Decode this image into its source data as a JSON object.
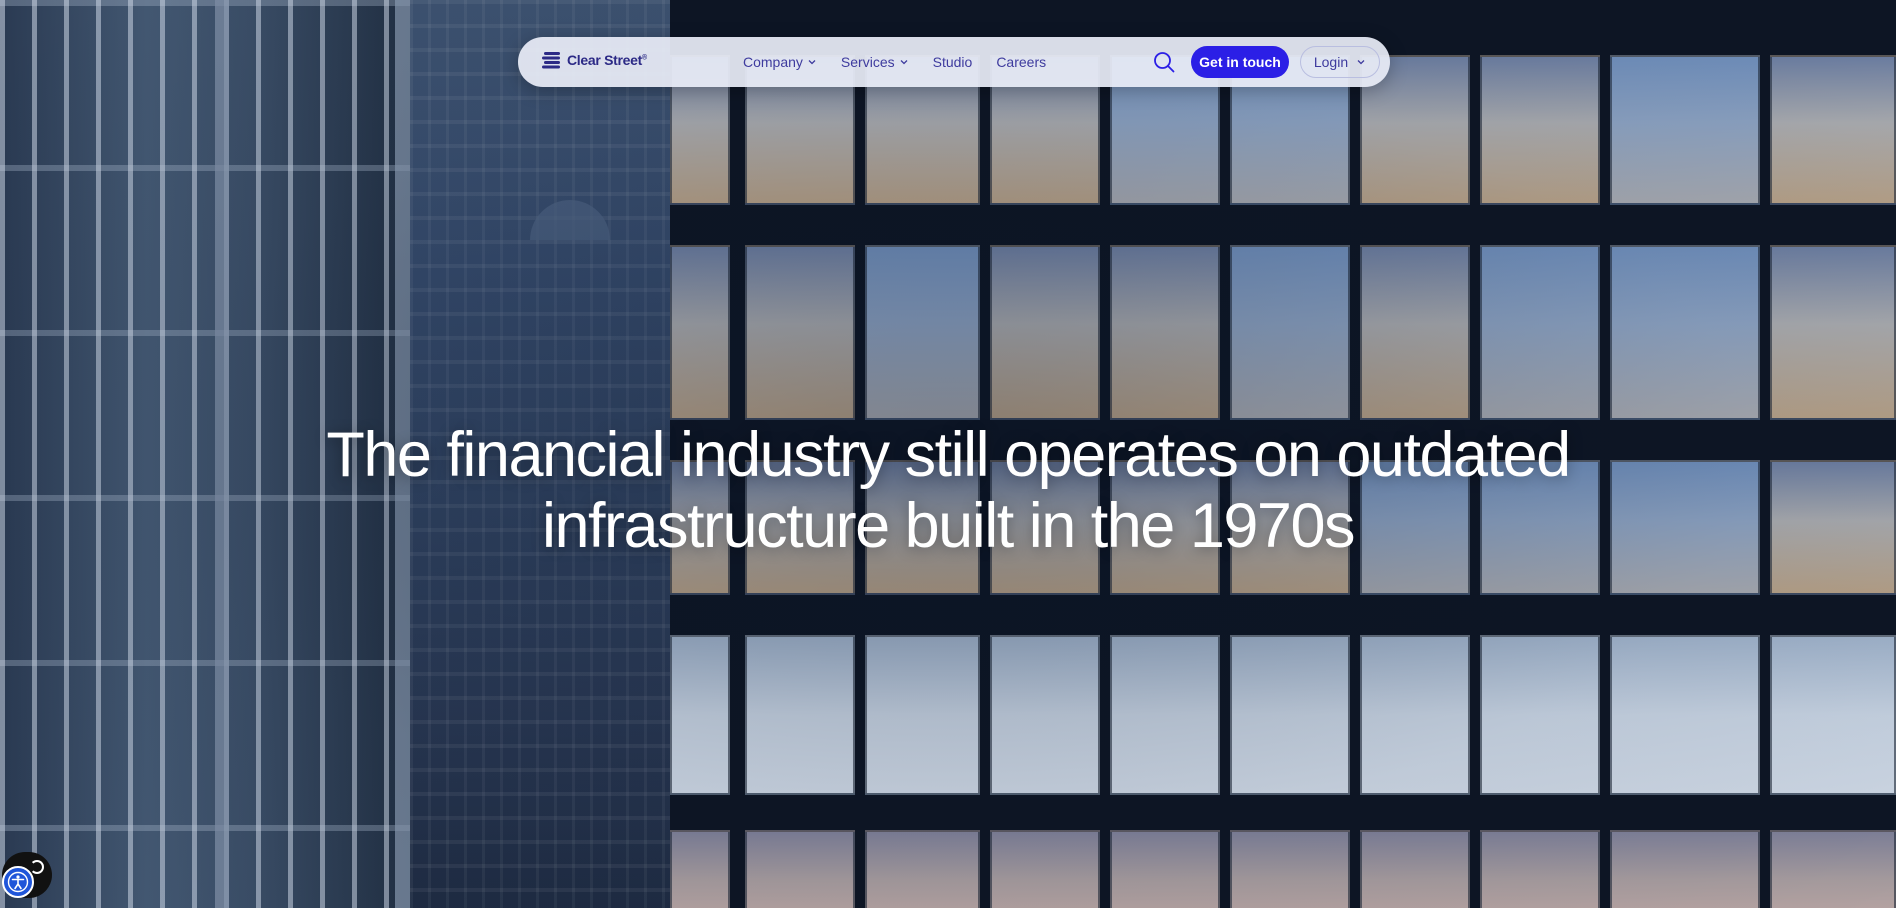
{
  "brand": {
    "name": "Clear Street",
    "mark": "®",
    "color": "#2c2a86"
  },
  "nav": {
    "items": [
      {
        "label": "Company",
        "has_dropdown": true
      },
      {
        "label": "Services",
        "has_dropdown": true
      },
      {
        "label": "Studio",
        "has_dropdown": false
      },
      {
        "label": "Careers",
        "has_dropdown": false
      }
    ],
    "search_icon": "search-icon",
    "cta_label": "Get in touch",
    "login_label": "Login"
  },
  "hero": {
    "headline_line1": "The financial industry still operates on outdated",
    "headline_line2": "infrastructure built in the 1970s"
  },
  "accessibility": {
    "icon": "accessibility-icon"
  },
  "colors": {
    "accent": "#2b1fe6",
    "nav_text": "#3e3b9e",
    "nav_bg": "#e8ecf6"
  }
}
